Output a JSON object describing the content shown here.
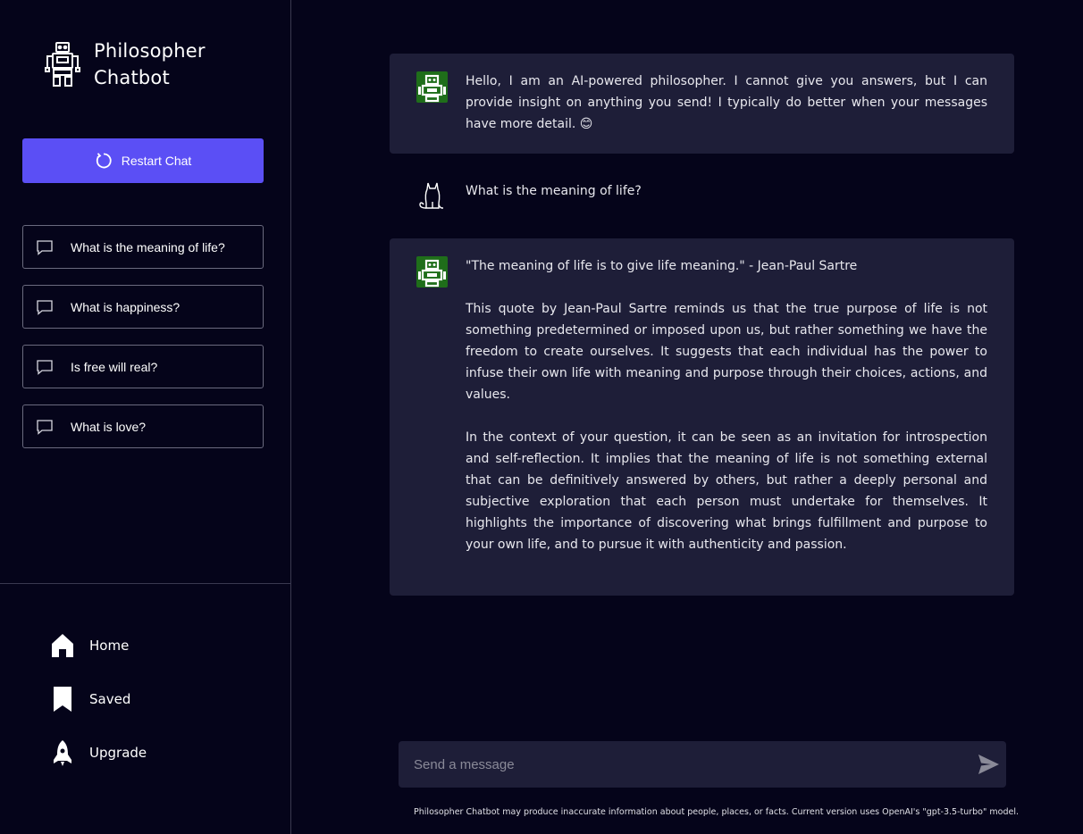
{
  "app": {
    "title_line1": "Philosopher",
    "title_line2": "Chatbot",
    "logo_icon": "robot-icon"
  },
  "sidebar": {
    "restart_label": "Restart Chat",
    "restart_icon": "refresh-icon",
    "prompts": [
      {
        "label": "What is the meaning of life?",
        "icon": "chat-bubble-icon"
      },
      {
        "label": "What is happiness?",
        "icon": "chat-bubble-icon"
      },
      {
        "label": "Is free will real?",
        "icon": "chat-bubble-icon"
      },
      {
        "label": "What is love?",
        "icon": "chat-bubble-icon"
      }
    ],
    "nav": [
      {
        "label": "Home",
        "icon": "home-icon"
      },
      {
        "label": "Saved",
        "icon": "bookmark-icon"
      },
      {
        "label": "Upgrade",
        "icon": "rocket-icon"
      }
    ]
  },
  "chat": {
    "messages": [
      {
        "role": "bot",
        "avatar": "robot-avatar-icon",
        "paragraphs": [
          "Hello, I am an AI-powered philosopher. I cannot give you answers, but I can provide insight on anything you send! I typically do better when your messages have more detail. 😊"
        ]
      },
      {
        "role": "user",
        "avatar": "cat-avatar-icon",
        "paragraphs": [
          "What is the meaning of life?"
        ]
      },
      {
        "role": "bot",
        "avatar": "robot-avatar-icon",
        "paragraphs": [
          "\"The meaning of life is to give life meaning.\" - Jean-Paul Sartre",
          "This quote by Jean-Paul Sartre reminds us that the true purpose of life is not something predetermined or imposed upon us, but rather something we have the freedom to create ourselves. It suggests that each individual has the power to infuse their own life with meaning and purpose through their choices, actions, and values.",
          "In the context of your question, it can be seen as an invitation for introspection and self-reflection. It implies that the meaning of life is not something external that can be definitively answered by others, but rather a deeply personal and subjective exploration that each person must undertake for themselves. It highlights the importance of discovering what brings fulfillment and purpose to your own life, and to pursue it with authenticity and passion."
        ]
      }
    ],
    "input_placeholder": "Send a message",
    "send_icon": "send-icon",
    "disclaimer": "Philosopher Chatbot may produce inaccurate information about people, places, or facts. Current version uses OpenAI's \"gpt-3.5-turbo\" model."
  },
  "colors": {
    "background": "#05041a",
    "panel": "#1e1e38",
    "accent": "#5b4ff5",
    "bot_avatar": "#1f6e1a"
  }
}
